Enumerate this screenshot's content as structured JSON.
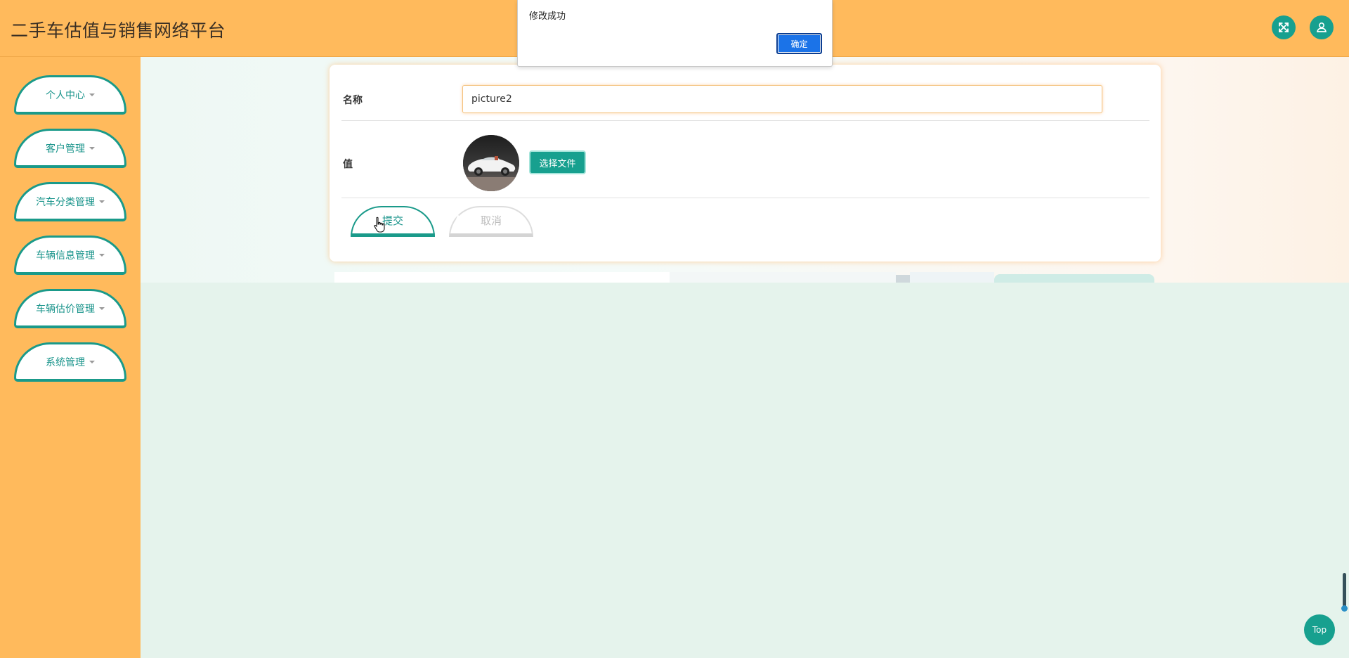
{
  "header": {
    "title": "二手车估值与销售网络平台",
    "fullscreen_icon": "expand-arrows-icon",
    "user_icon": "user-icon"
  },
  "sidebar": {
    "items": [
      {
        "label": "个人中心"
      },
      {
        "label": "客户管理"
      },
      {
        "label": "汽车分类管理"
      },
      {
        "label": "车辆信息管理"
      },
      {
        "label": "车辆估价管理"
      },
      {
        "label": "系统管理"
      }
    ]
  },
  "form": {
    "name_label": "名称",
    "name_value": "picture2",
    "value_label": "值",
    "choose_file_label": "选择文件",
    "submit_label": "提交",
    "cancel_label": "取消"
  },
  "alert": {
    "message": "修改成功",
    "ok_label": "确定"
  },
  "top_button": {
    "label": "Top"
  },
  "colors": {
    "header_bg": "#ffba5c",
    "accent": "#17a08f",
    "content_bg": "#e5f3ec",
    "alert_button": "#1b73e8"
  }
}
